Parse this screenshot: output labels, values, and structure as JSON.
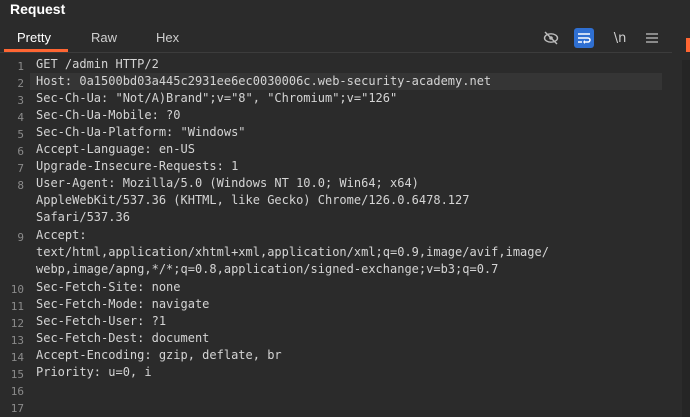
{
  "header": {
    "title": "Request"
  },
  "tabs": [
    {
      "label": "Pretty",
      "active": true
    },
    {
      "label": "Raw",
      "active": false
    },
    {
      "label": "Hex",
      "active": false
    }
  ],
  "toolbar": {
    "hide_icon": "eye-slash-icon",
    "wrap_icon": "word-wrap-icon",
    "newline_label": "\\n",
    "menu_icon": "hamburger-menu-icon"
  },
  "colors": {
    "accent": "#ff6633",
    "active_toggle": "#2f6fd1",
    "background": "#2b2b2b"
  },
  "editor": {
    "line_numbers": [
      "1",
      "2",
      "3",
      "4",
      "5",
      "6",
      "7",
      "8",
      "9",
      "10",
      "11",
      "12",
      "13",
      "14",
      "15",
      "16",
      "17"
    ],
    "lines": [
      "GET /admin HTTP/2",
      "Host: 0a1500bd03a445c2931ee6ec0030006c.web-security-academy.net",
      "Sec-Ch-Ua: \"Not/A)Brand\";v=\"8\", \"Chromium\";v=\"126\"",
      "Sec-Ch-Ua-Mobile: ?0",
      "Sec-Ch-Ua-Platform: \"Windows\"",
      "Accept-Language: en-US",
      "Upgrade-Insecure-Requests: 1",
      "User-Agent: Mozilla/5.0 (Windows NT 10.0; Win64; x64)",
      "AppleWebKit/537.36 (KHTML, like Gecko) Chrome/126.0.6478.127",
      "Safari/537.36",
      "Accept:",
      "text/html,application/xhtml+xml,application/xml;q=0.9,image/avif,image/",
      "webp,image/apng,*/*;q=0.8,application/signed-exchange;v=b3;q=0.7",
      "Sec-Fetch-Site: none",
      "Sec-Fetch-Mode: navigate",
      "Sec-Fetch-User: ?1",
      "Sec-Fetch-Dest: document",
      "Accept-Encoding: gzip, deflate, br",
      "Priority: u=0, i"
    ]
  }
}
